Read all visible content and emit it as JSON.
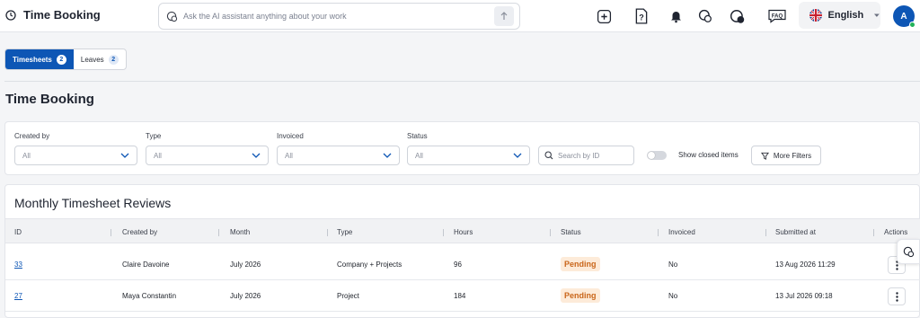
{
  "header": {
    "app_title": "Time Booking",
    "ai_placeholder": "Ask the AI assistant anything about your work",
    "language": "English",
    "avatar_initial": "A",
    "icons": [
      "clock-icon",
      "chat-icon",
      "send-arrow-icon",
      "add-square-icon",
      "help-doc-icon",
      "bell-icon",
      "ai-chat-icon",
      "chat-bubble-icon",
      "faq-icon",
      "uk-flag-icon",
      "caret-down-icon"
    ]
  },
  "tabs": [
    {
      "label": "Timesheets",
      "count": "2"
    },
    {
      "label": "Leaves",
      "count": "2"
    }
  ],
  "page_title": "Time Booking",
  "filters": {
    "created_by": {
      "label": "Created by",
      "value": "All"
    },
    "type": {
      "label": "Type",
      "value": "All"
    },
    "invoiced": {
      "label": "Invoiced",
      "value": "All"
    },
    "status": {
      "label": "Status",
      "value": "All"
    },
    "search_placeholder": "Search by ID",
    "toggle_label": "Show closed items",
    "more_filters": "More Filters"
  },
  "table": {
    "title": "Monthly Timesheet Reviews",
    "columns": [
      "ID",
      "Created by",
      "Month",
      "Type",
      "Hours",
      "Status",
      "Invoiced",
      "Submitted at",
      "Actions"
    ],
    "rows": [
      {
        "id": "33",
        "created_by": "Claire Davoine",
        "month": "July 2026",
        "type": "Company + Projects",
        "hours": "96",
        "status": "Pending",
        "invoiced": "No",
        "submitted_at": "13 Aug 2026 11:29"
      },
      {
        "id": "27",
        "created_by": "Maya Constantin",
        "month": "July 2026",
        "type": "Project",
        "hours": "184",
        "status": "Pending",
        "invoiced": "No",
        "submitted_at": "13 Jul 2026 09:18"
      }
    ]
  },
  "colors": {
    "primary": "#0d56b5",
    "pending_text": "#c9661a",
    "pending_bg": "#fdebd9",
    "online": "#21b25a"
  }
}
